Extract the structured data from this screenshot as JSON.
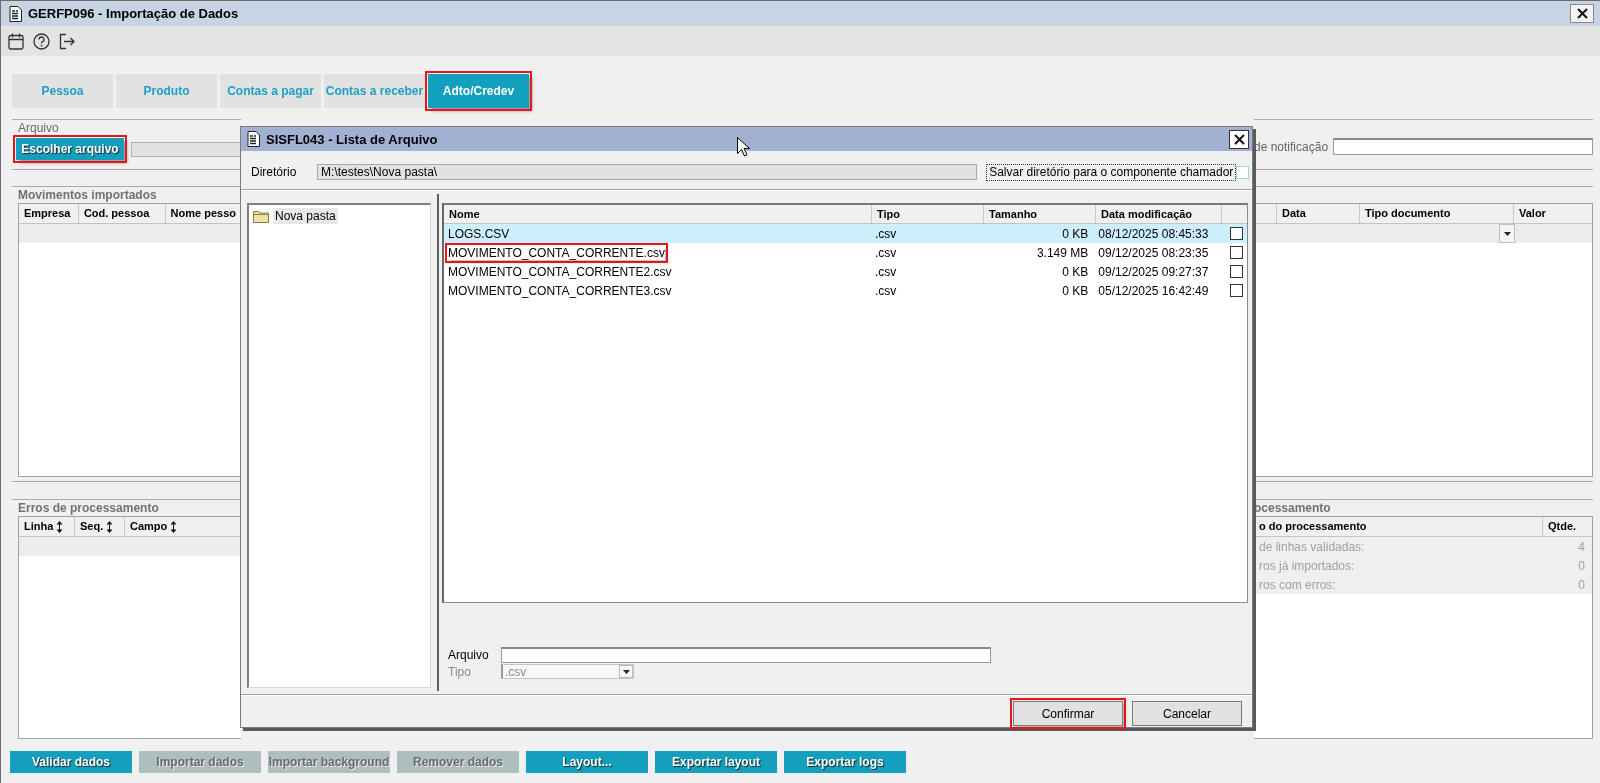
{
  "window": {
    "title": "GERFP096 - Importação de Dados"
  },
  "tabs": [
    {
      "label": "Pessoa",
      "selected": false,
      "highlighted": false
    },
    {
      "label": "Produto",
      "selected": false,
      "highlighted": false
    },
    {
      "label": "Contas a pagar",
      "selected": false,
      "highlighted": false
    },
    {
      "label": "Contas a receber",
      "selected": false,
      "highlighted": false
    },
    {
      "label": "Adto/Credev",
      "selected": true,
      "highlighted": true
    }
  ],
  "arquivo": {
    "label": "Arquivo",
    "choose_button": {
      "label": "Escolher arquivo",
      "highlighted": true
    },
    "notification_label": "de notificação"
  },
  "movimentos": {
    "title": "Movimentos importados",
    "left_columns": [
      "Empresa",
      "Cod. pessoa",
      "Nome pesso"
    ],
    "right_columns": [
      "Data",
      "Tipo documento",
      "Valor"
    ]
  },
  "erros": {
    "title": "Erros de processamento",
    "columns": [
      "Linha",
      "Seq.",
      "Campo"
    ]
  },
  "resumo": {
    "title": "ocessamento",
    "columns": [
      "o do processamento",
      "Qtde."
    ],
    "rows": [
      {
        "label": "de linhas validadas:",
        "value": "4"
      },
      {
        "label": "ros já importados:",
        "value": "0"
      },
      {
        "label": "ros com erros:",
        "value": "0"
      }
    ]
  },
  "buttons": [
    {
      "label": "Validar dados",
      "disabled": false
    },
    {
      "label": "Importar dados",
      "disabled": true
    },
    {
      "label": "Importar background",
      "disabled": true
    },
    {
      "label": "Remover dados",
      "disabled": true
    },
    {
      "label": "Layout...",
      "disabled": false
    },
    {
      "label": "Exportar layout",
      "disabled": false
    },
    {
      "label": "Exportar logs",
      "disabled": false
    }
  ],
  "dialog": {
    "title": "SISFL043 - Lista de Arquivo",
    "directory_label": "Diretório",
    "directory": "M:\\testes\\Nova pasta\\",
    "save_label": "Salvar diretório para o componente chamador",
    "save_checked": false,
    "folders": [
      {
        "name": "Nova pasta",
        "selected": true
      }
    ],
    "files": {
      "columns": [
        "Nome",
        "Tipo",
        "Tamanho",
        "Data modificação"
      ],
      "rows": [
        {
          "name": "LOGS.CSV",
          "type": ".csv",
          "size": "0 KB",
          "modified": "08/12/2025 08:45:33",
          "checked": false,
          "selected": true,
          "highlighted": false
        },
        {
          "name": "MOVIMENTO_CONTA_CORRENTE.csv",
          "type": ".csv",
          "size": "3.149 MB",
          "modified": "09/12/2025 08:23:35",
          "checked": false,
          "selected": false,
          "highlighted": true
        },
        {
          "name": "MOVIMENTO_CONTA_CORRENTE2.csv",
          "type": ".csv",
          "size": "0 KB",
          "modified": "09/12/2025 09:27:37",
          "checked": false,
          "selected": false,
          "highlighted": false
        },
        {
          "name": "MOVIMENTO_CONTA_CORRENTE3.csv",
          "type": ".csv",
          "size": "0 KB",
          "modified": "05/12/2025 16:42:49",
          "checked": false,
          "selected": false,
          "highlighted": false
        }
      ]
    },
    "file_label": "Arquivo",
    "type_label": "Tipo",
    "type_value": ".csv",
    "buttons": [
      {
        "label": "Confirmar",
        "highlighted": true
      },
      {
        "label": "Cancelar",
        "highlighted": false
      }
    ]
  }
}
